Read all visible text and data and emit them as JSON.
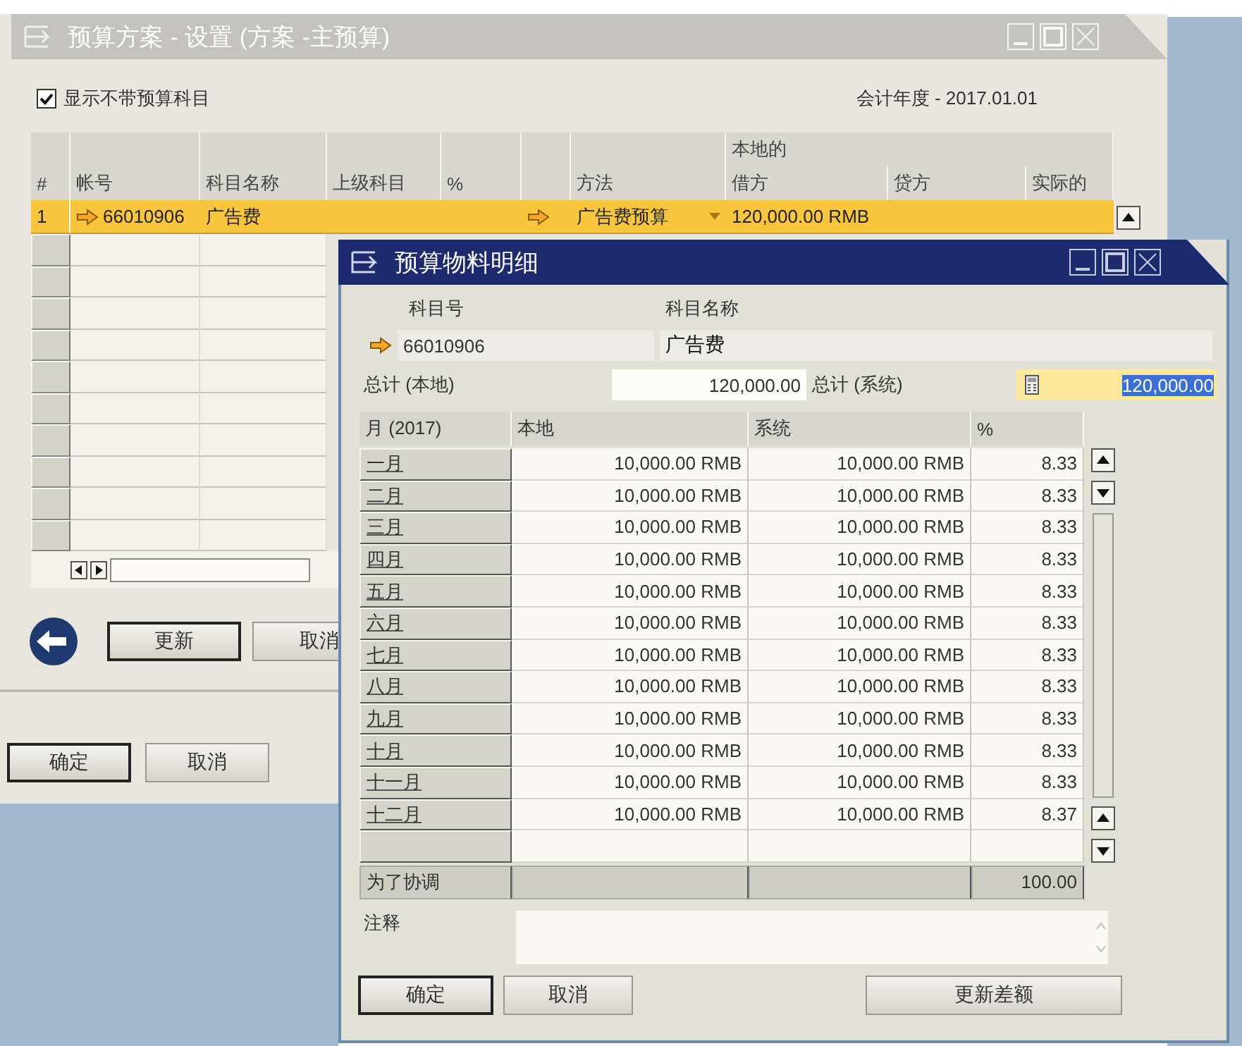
{
  "back_window": {
    "title": "预算方案 - 设置 (方案 -主预算)",
    "active": false,
    "show_without_budget": {
      "label": "显示不带预算科目",
      "checked": true
    },
    "fiscal_year": "会计年度 - 2017.01.01",
    "table": {
      "group_header": "本地的",
      "columns": [
        "#",
        "帐号",
        "科目名称",
        "上级科目",
        "%",
        "",
        "方法",
        "借方",
        "贷方",
        "实际的"
      ],
      "rows": [
        {
          "number": "1",
          "account": "66010906",
          "name": "广告费",
          "parent": "",
          "percent": "",
          "method": "广告费预算",
          "debit": "120,000.00 RMB",
          "credit": "",
          "actual": "",
          "selected": true
        }
      ]
    },
    "buttons": [
      "更新",
      "取消"
    ],
    "footer_buttons": [
      "确定",
      "取消"
    ]
  },
  "front_window": {
    "title": "预算物料明细",
    "active": true,
    "account_no_label": "科目号",
    "account_name_label": "科目名称",
    "account_no": "66010906",
    "account_name": "广告费",
    "total_local_label": "总计 (本地)",
    "total_local": "120,000.00",
    "total_system_label": "总计 (系统)",
    "total_system": "120,000.00",
    "total_system_highlighted": true,
    "columns": [
      "月 (2017)",
      "本地",
      "系统",
      "%"
    ],
    "months": [
      {
        "month": "一月",
        "local": "10,000.00 RMB",
        "system": "10,000.00 RMB",
        "percent": "8.33"
      },
      {
        "month": "二月",
        "local": "10,000.00 RMB",
        "system": "10,000.00 RMB",
        "percent": "8.33"
      },
      {
        "month": "三月",
        "local": "10,000.00 RMB",
        "system": "10,000.00 RMB",
        "percent": "8.33"
      },
      {
        "month": "四月",
        "local": "10,000.00 RMB",
        "system": "10,000.00 RMB",
        "percent": "8.33"
      },
      {
        "month": "五月",
        "local": "10,000.00 RMB",
        "system": "10,000.00 RMB",
        "percent": "8.33"
      },
      {
        "month": "六月",
        "local": "10,000.00 RMB",
        "system": "10,000.00 RMB",
        "percent": "8.33"
      },
      {
        "month": "七月",
        "local": "10,000.00 RMB",
        "system": "10,000.00 RMB",
        "percent": "8.33"
      },
      {
        "month": "八月",
        "local": "10,000.00 RMB",
        "system": "10,000.00 RMB",
        "percent": "8.33"
      },
      {
        "month": "九月",
        "local": "10,000.00 RMB",
        "system": "10,000.00 RMB",
        "percent": "8.33"
      },
      {
        "month": "十月",
        "local": "10,000.00 RMB",
        "system": "10,000.00 RMB",
        "percent": "8.33"
      },
      {
        "month": "十一月",
        "local": "10,000.00 RMB",
        "system": "10,000.00 RMB",
        "percent": "8.33"
      },
      {
        "month": "十二月",
        "local": "10,000.00 RMB",
        "system": "10,000.00 RMB",
        "percent": "8.37"
      }
    ],
    "reconcile": {
      "label": "为了协调",
      "percent": "100.00"
    },
    "remarks_label": "注释",
    "buttons": [
      {
        "label": "确定",
        "kind": "default"
      },
      {
        "label": "取消",
        "kind": "normal"
      },
      {
        "label": "更新差额",
        "kind": "wide"
      }
    ]
  }
}
